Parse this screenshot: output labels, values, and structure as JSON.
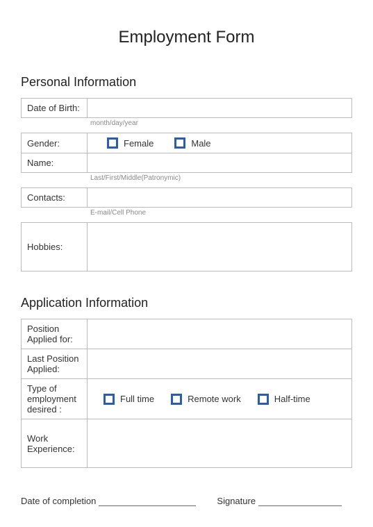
{
  "title": "Employment Form",
  "sections": {
    "personal": {
      "heading": "Personal Information",
      "dob_label": "Date of Birth:",
      "dob_hint": "month/day/year",
      "gender_label": "Gender:",
      "gender_female": "Female",
      "gender_male": "Male",
      "name_label": "Name:",
      "name_hint": "Last/First/Middle(Patronymic)",
      "contacts_label": "Contacts:",
      "contacts_hint": "E-mail/Cell Phone",
      "hobbies_label": "Hobbies:"
    },
    "application": {
      "heading": "Application Information",
      "position_label": "Position Applied for:",
      "last_position_label": "Last Position Applied:",
      "emp_type_label": "Type of employment desired :",
      "emp_full": "Full time",
      "emp_remote": "Remote work",
      "emp_half": "Half-time",
      "work_exp_label": "Work Experience:"
    }
  },
  "footer": {
    "date_label": "Date of completion",
    "signature_label": "Signature"
  }
}
